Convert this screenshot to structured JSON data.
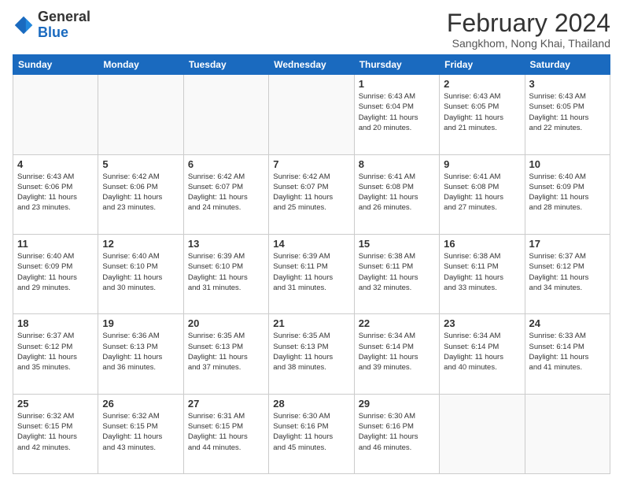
{
  "header": {
    "logo_line1": "General",
    "logo_line2": "Blue",
    "month_title": "February 2024",
    "subtitle": "Sangkhom, Nong Khai, Thailand"
  },
  "days_of_week": [
    "Sunday",
    "Monday",
    "Tuesday",
    "Wednesday",
    "Thursday",
    "Friday",
    "Saturday"
  ],
  "weeks": [
    [
      {
        "day": "",
        "info": ""
      },
      {
        "day": "",
        "info": ""
      },
      {
        "day": "",
        "info": ""
      },
      {
        "day": "",
        "info": ""
      },
      {
        "day": "1",
        "info": "Sunrise: 6:43 AM\nSunset: 6:04 PM\nDaylight: 11 hours\nand 20 minutes."
      },
      {
        "day": "2",
        "info": "Sunrise: 6:43 AM\nSunset: 6:05 PM\nDaylight: 11 hours\nand 21 minutes."
      },
      {
        "day": "3",
        "info": "Sunrise: 6:43 AM\nSunset: 6:05 PM\nDaylight: 11 hours\nand 22 minutes."
      }
    ],
    [
      {
        "day": "4",
        "info": "Sunrise: 6:43 AM\nSunset: 6:06 PM\nDaylight: 11 hours\nand 23 minutes."
      },
      {
        "day": "5",
        "info": "Sunrise: 6:42 AM\nSunset: 6:06 PM\nDaylight: 11 hours\nand 23 minutes."
      },
      {
        "day": "6",
        "info": "Sunrise: 6:42 AM\nSunset: 6:07 PM\nDaylight: 11 hours\nand 24 minutes."
      },
      {
        "day": "7",
        "info": "Sunrise: 6:42 AM\nSunset: 6:07 PM\nDaylight: 11 hours\nand 25 minutes."
      },
      {
        "day": "8",
        "info": "Sunrise: 6:41 AM\nSunset: 6:08 PM\nDaylight: 11 hours\nand 26 minutes."
      },
      {
        "day": "9",
        "info": "Sunrise: 6:41 AM\nSunset: 6:08 PM\nDaylight: 11 hours\nand 27 minutes."
      },
      {
        "day": "10",
        "info": "Sunrise: 6:40 AM\nSunset: 6:09 PM\nDaylight: 11 hours\nand 28 minutes."
      }
    ],
    [
      {
        "day": "11",
        "info": "Sunrise: 6:40 AM\nSunset: 6:09 PM\nDaylight: 11 hours\nand 29 minutes."
      },
      {
        "day": "12",
        "info": "Sunrise: 6:40 AM\nSunset: 6:10 PM\nDaylight: 11 hours\nand 30 minutes."
      },
      {
        "day": "13",
        "info": "Sunrise: 6:39 AM\nSunset: 6:10 PM\nDaylight: 11 hours\nand 31 minutes."
      },
      {
        "day": "14",
        "info": "Sunrise: 6:39 AM\nSunset: 6:11 PM\nDaylight: 11 hours\nand 31 minutes."
      },
      {
        "day": "15",
        "info": "Sunrise: 6:38 AM\nSunset: 6:11 PM\nDaylight: 11 hours\nand 32 minutes."
      },
      {
        "day": "16",
        "info": "Sunrise: 6:38 AM\nSunset: 6:11 PM\nDaylight: 11 hours\nand 33 minutes."
      },
      {
        "day": "17",
        "info": "Sunrise: 6:37 AM\nSunset: 6:12 PM\nDaylight: 11 hours\nand 34 minutes."
      }
    ],
    [
      {
        "day": "18",
        "info": "Sunrise: 6:37 AM\nSunset: 6:12 PM\nDaylight: 11 hours\nand 35 minutes."
      },
      {
        "day": "19",
        "info": "Sunrise: 6:36 AM\nSunset: 6:13 PM\nDaylight: 11 hours\nand 36 minutes."
      },
      {
        "day": "20",
        "info": "Sunrise: 6:35 AM\nSunset: 6:13 PM\nDaylight: 11 hours\nand 37 minutes."
      },
      {
        "day": "21",
        "info": "Sunrise: 6:35 AM\nSunset: 6:13 PM\nDaylight: 11 hours\nand 38 minutes."
      },
      {
        "day": "22",
        "info": "Sunrise: 6:34 AM\nSunset: 6:14 PM\nDaylight: 11 hours\nand 39 minutes."
      },
      {
        "day": "23",
        "info": "Sunrise: 6:34 AM\nSunset: 6:14 PM\nDaylight: 11 hours\nand 40 minutes."
      },
      {
        "day": "24",
        "info": "Sunrise: 6:33 AM\nSunset: 6:14 PM\nDaylight: 11 hours\nand 41 minutes."
      }
    ],
    [
      {
        "day": "25",
        "info": "Sunrise: 6:32 AM\nSunset: 6:15 PM\nDaylight: 11 hours\nand 42 minutes."
      },
      {
        "day": "26",
        "info": "Sunrise: 6:32 AM\nSunset: 6:15 PM\nDaylight: 11 hours\nand 43 minutes."
      },
      {
        "day": "27",
        "info": "Sunrise: 6:31 AM\nSunset: 6:15 PM\nDaylight: 11 hours\nand 44 minutes."
      },
      {
        "day": "28",
        "info": "Sunrise: 6:30 AM\nSunset: 6:16 PM\nDaylight: 11 hours\nand 45 minutes."
      },
      {
        "day": "29",
        "info": "Sunrise: 6:30 AM\nSunset: 6:16 PM\nDaylight: 11 hours\nand 46 minutes."
      },
      {
        "day": "",
        "info": ""
      },
      {
        "day": "",
        "info": ""
      }
    ]
  ]
}
